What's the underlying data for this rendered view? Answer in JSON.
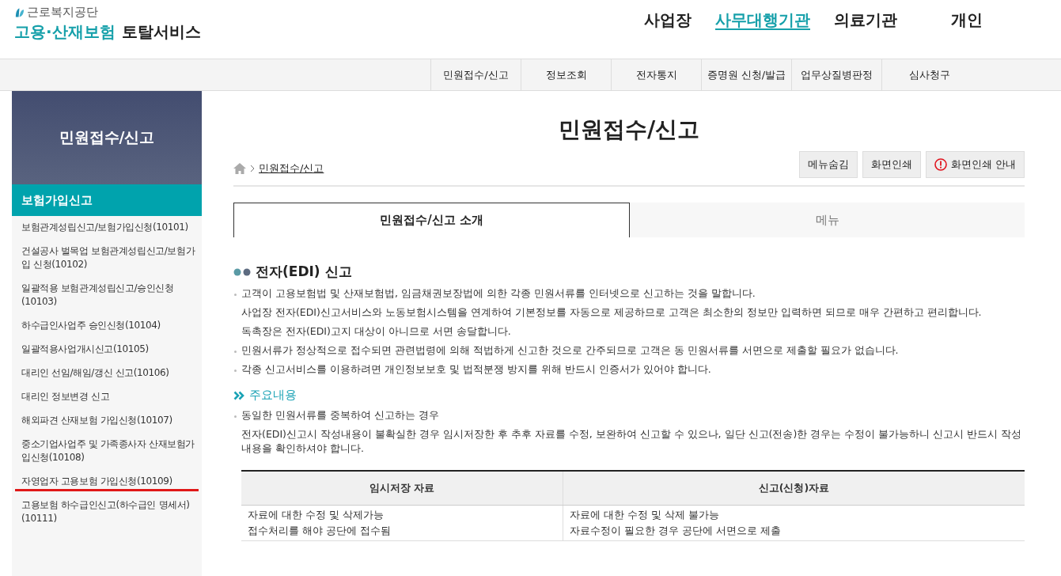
{
  "logo": {
    "org": "근로복지공단",
    "title_colored": "고용·산재보험",
    "title_dark": "토탈서비스"
  },
  "top_nav": [
    {
      "label": "사업장",
      "selected": false
    },
    {
      "label": "사무대행기관",
      "selected": true
    },
    {
      "label": "의료기관",
      "selected": false
    },
    {
      "label": "개인",
      "selected": false
    }
  ],
  "sub_nav": [
    "민원접수/신고",
    "정보조회",
    "전자통지",
    "증명원 신청/발급",
    "업무상질병판정",
    "심사청구"
  ],
  "sidebar": {
    "title": "민원접수/신고",
    "section": "보험가입신고",
    "items": [
      {
        "label": "보험관계성립신고/보험가입신청(10101)",
        "underlined": false
      },
      {
        "label": "건설공사 벌목업 보험관계성립신고/보험가입 신청(10102)",
        "underlined": false
      },
      {
        "label": "일괄적용 보험관계성립신고/승인신청(10103)",
        "underlined": false
      },
      {
        "label": "하수급인사업주 승인신청(10104)",
        "underlined": false
      },
      {
        "label": "일괄적용사업개시신고(10105)",
        "underlined": false
      },
      {
        "label": "대리인 선임/해임/갱신 신고(10106)",
        "underlined": false
      },
      {
        "label": "대리인 정보변경 신고",
        "underlined": false
      },
      {
        "label": "해외파견 산재보험 가입신청(10107)",
        "underlined": false
      },
      {
        "label": "중소기업사업주 및 가족종사자 산재보험가입신청(10108)",
        "underlined": false
      },
      {
        "label": "자영업자 고용보험 가입신청(10109)",
        "underlined": true
      },
      {
        "label": "고용보험 하수급인신고(하수급인 명세서)(10111)",
        "underlined": false
      }
    ]
  },
  "page_title": "민원접수/신고",
  "breadcrumb": "민원접수/신고",
  "buttons": [
    {
      "label": "메뉴숨김",
      "kind": "plain"
    },
    {
      "label": "화면인쇄",
      "kind": "plain"
    },
    {
      "label": "화면인쇄 안내",
      "kind": "info"
    }
  ],
  "tabs": [
    {
      "label": "민원접수/신고 소개",
      "selected": true
    },
    {
      "label": "메뉴",
      "selected": false
    }
  ],
  "section1": {
    "heading": "전자(EDI) 신고",
    "bullets": [
      {
        "lines": [
          "고객이 고용보험법 및 산재보험법, 임금채권보장법에 의한 각종 민원서류를 인터넷으로 신고하는 것을 말합니다.",
          "사업장 전자(EDI)신고서비스와 노동보험시스템을 연계하여 기본정보를 자동으로 제공하므로 고객은 최소한의 정보만 입력하면 되므로 매우 간편하고 편리합니다.",
          "독촉장은 전자(EDI)고지 대상이 아니므로 서면 송달합니다."
        ]
      },
      {
        "lines": [
          "민원서류가 정상적으로 접수되면 관련법령에 의해 적법하게 신고한 것으로 간주되므로 고객은 동 민원서류를 서면으로 제출할 필요가 없습니다."
        ]
      },
      {
        "lines": [
          "각종 신고서비스를 이용하려면 개인정보보호 및 법적분쟁 방지를 위해 반드시 인증서가 있어야 합니다."
        ]
      }
    ]
  },
  "section2": {
    "heading": "주요내용",
    "bullets": [
      {
        "lines": [
          "동일한 민원서류를 중복하여 신고하는 경우",
          "전자(EDI)신고시 작성내용이 불확실한 경우 임시저장한 후 추후 자료를 수정, 보완하여 신고할 수 있으나, 일단 신고(전송)한 경우는 수정이 불가능하니 신고시 반드시 작성내용을 확인하셔야 합니다."
        ]
      }
    ]
  },
  "table": {
    "columns": [
      "임시저장 자료",
      "신고(신청)자료"
    ],
    "rows": [
      [
        "자료에 대한 수정 및 삭제가능\n접수처리를 해야 공단에 접수됨",
        "자료에 대한 수정 및 삭제 불가능\n자료수정이 필요한 경우 공단에 서면으로 제출"
      ]
    ]
  }
}
